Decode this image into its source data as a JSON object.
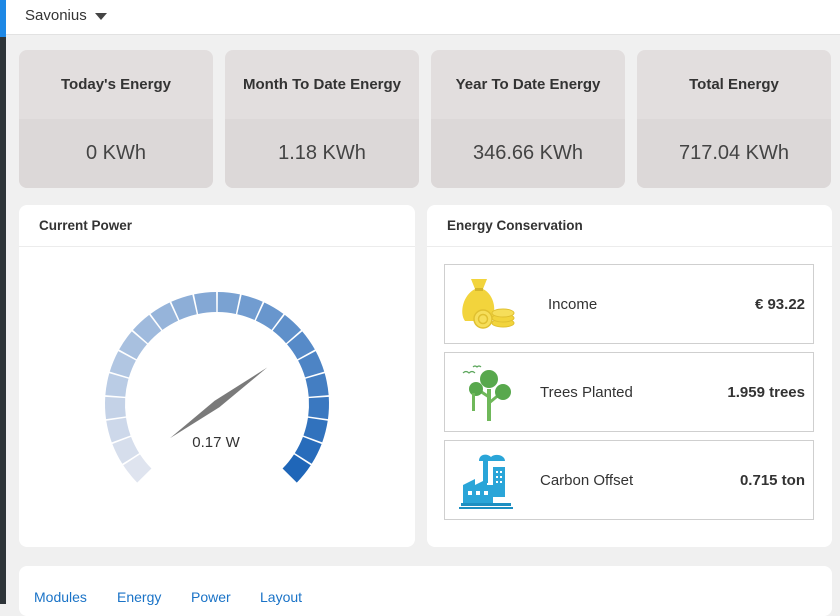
{
  "site_selector": {
    "value": "Savonius"
  },
  "kpis": [
    {
      "label": "Today's Energy",
      "value": "0 KWh"
    },
    {
      "label": "Month To Date Energy",
      "value": "1.18 KWh"
    },
    {
      "label": "Year To Date Energy",
      "value": "346.66 KWh"
    },
    {
      "label": "Total Energy",
      "value": "717.04 KWh"
    }
  ],
  "current_power": {
    "title": "Current Power",
    "reading": "0.17 W",
    "gauge_level": 0.7
  },
  "energy_conservation": {
    "title": "Energy Conservation",
    "items": [
      {
        "label": "Income",
        "value": "€ 93.22",
        "icon": "money-bag-icon"
      },
      {
        "label": "Trees Planted",
        "value": "1.959 trees",
        "icon": "trees-icon"
      },
      {
        "label": "Carbon Offset",
        "value": "0.715 ton",
        "icon": "factory-icon"
      }
    ]
  },
  "nav_tabs": [
    "Modules",
    "Energy",
    "Power",
    "Layout"
  ],
  "colors": {
    "kpi_bg": "#e2dede",
    "gauge_start": "#dfe4ef",
    "gauge_end": "#1f66b8",
    "needle": "#7a7a7a",
    "link": "#1a73c7",
    "accent": "#1e88e5"
  }
}
